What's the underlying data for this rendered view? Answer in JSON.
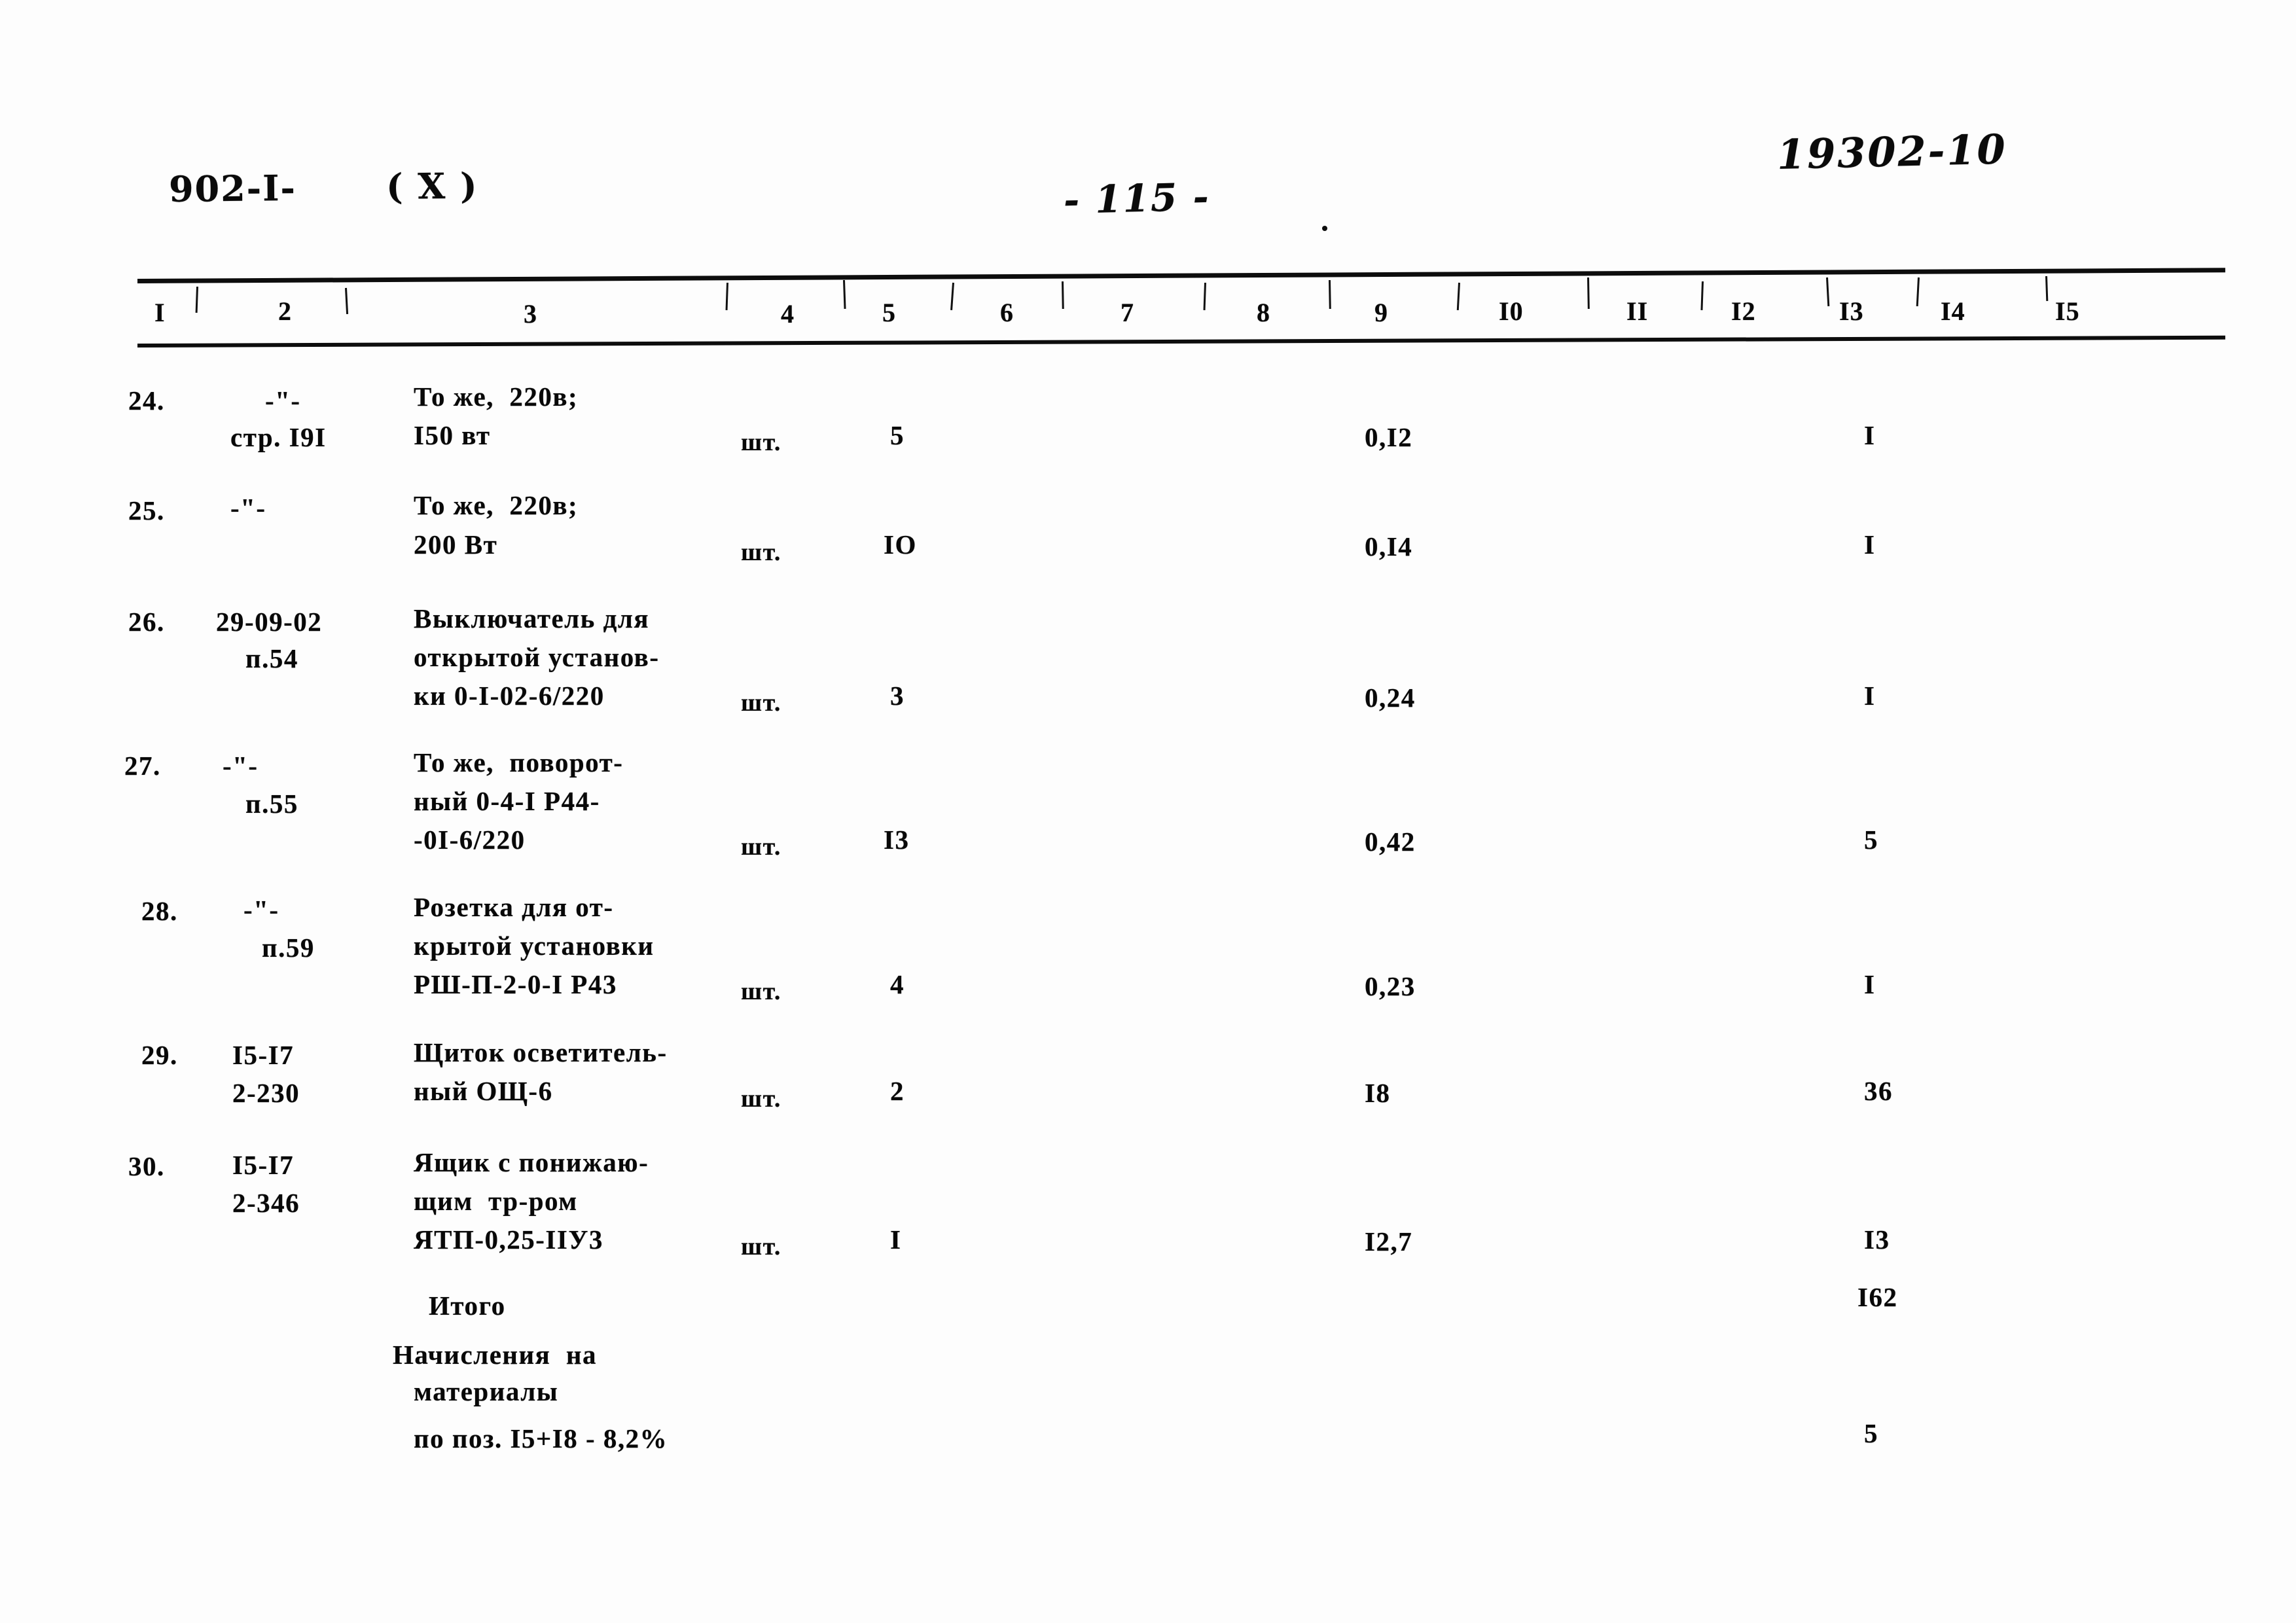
{
  "document": {
    "album_code": "902-I-",
    "album_variant": "( X )",
    "page_number": "- 115 -",
    "archive_stamp": "19302-10"
  },
  "table": {
    "column_headers": [
      "I",
      "2",
      "3",
      "4",
      "5",
      "6",
      "7",
      "8",
      "9",
      "I0",
      "II",
      "I2",
      "I3",
      "I4",
      "I5"
    ],
    "rows": [
      {
        "num": "24.",
        "code_line1": "-\"-",
        "code_line2": "стр. I9I",
        "desc_line1": "То же,  220в;",
        "desc_line2": "I50 вт",
        "desc_line3": "",
        "unit": "шт.",
        "qty": "5",
        "col9": "0,I2",
        "col13": "I"
      },
      {
        "num": "25.",
        "code_line1": "-\"-",
        "code_line2": "",
        "desc_line1": "То же,  220в;",
        "desc_line2": "200 Вт",
        "desc_line3": "",
        "unit": "шт.",
        "qty": "IO",
        "col9": "0,I4",
        "col13": "I"
      },
      {
        "num": "26.",
        "code_line1": "29-09-02",
        "code_line2": "п.54",
        "desc_line1": "Выключатель для",
        "desc_line2": "открытой установ-",
        "desc_line3": "ки 0-I-02-6/220",
        "unit": "шт.",
        "qty": "3",
        "col9": "0,24",
        "col13": "I"
      },
      {
        "num": "27.",
        "code_line1": "-\"-",
        "code_line2": "п.55",
        "desc_line1": "То же,  поворот-",
        "desc_line2": "ный 0-4-I Р44-",
        "desc_line3": "-0I-6/220",
        "unit": "шт.",
        "qty": "I3",
        "col9": "0,42",
        "col13": "5"
      },
      {
        "num": "28.",
        "code_line1": "-\"-",
        "code_line2": "п.59",
        "desc_line1": "Розетка для от-",
        "desc_line2": "крытой установки",
        "desc_line3": "РШ-П-2-0-I Р43",
        "unit": "шт.",
        "qty": "4",
        "col9": "0,23",
        "col13": "I"
      },
      {
        "num": "29.",
        "code_line1": "I5-I7",
        "code_line2": "2-230",
        "desc_line1": "Щиток осветитель-",
        "desc_line2": "ный ОЩ-6",
        "desc_line3": "",
        "unit": "шт.",
        "qty": "2",
        "col9": "I8",
        "col13": "36"
      },
      {
        "num": "30.",
        "code_line1": "I5-I7",
        "code_line2": "2-346",
        "desc_line1": "Ящик с понижаю-",
        "desc_line2": "щим  тр-ром",
        "desc_line3": "ЯТП-0,25-IIУ3",
        "unit": "шт.",
        "qty": "I",
        "col9": "I2,7",
        "col13": "I3"
      }
    ],
    "summary": [
      {
        "label_line1": "Итого",
        "label_line2": "",
        "label_line3": "",
        "col13": "I62"
      },
      {
        "label_line1": "Начисления  на",
        "label_line2": "материалы",
        "label_line3": "по поз. I5+I8 - 8,2%",
        "col13": "5"
      }
    ]
  }
}
